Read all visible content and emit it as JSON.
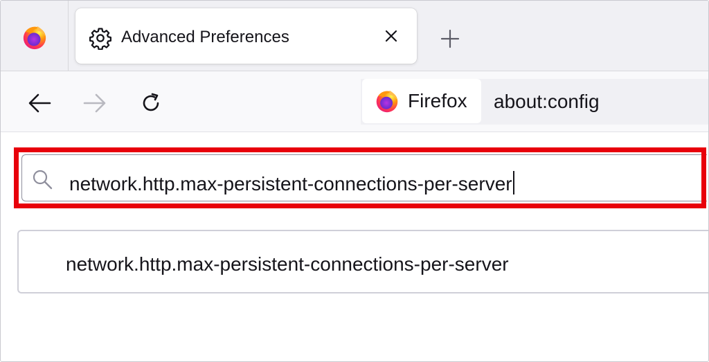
{
  "browser": "Firefox",
  "tabs": {
    "active": {
      "title": "Advanced Preferences",
      "icon": "gear-icon"
    },
    "pinned_icon": "firefox-logo",
    "close_symbol": "✕",
    "new_tab_symbol": "+"
  },
  "navbar": {
    "identity_label": "Firefox",
    "url": "about:config"
  },
  "config": {
    "search_value": "network.http.max-persistent-connections-per-server",
    "results": [
      {
        "name": "network.http.max-persistent-connections-per-server"
      }
    ]
  },
  "colors": {
    "highlight": "#e8000b",
    "tabstrip": "#f0f0f4",
    "navbar": "#f9f9fb"
  }
}
